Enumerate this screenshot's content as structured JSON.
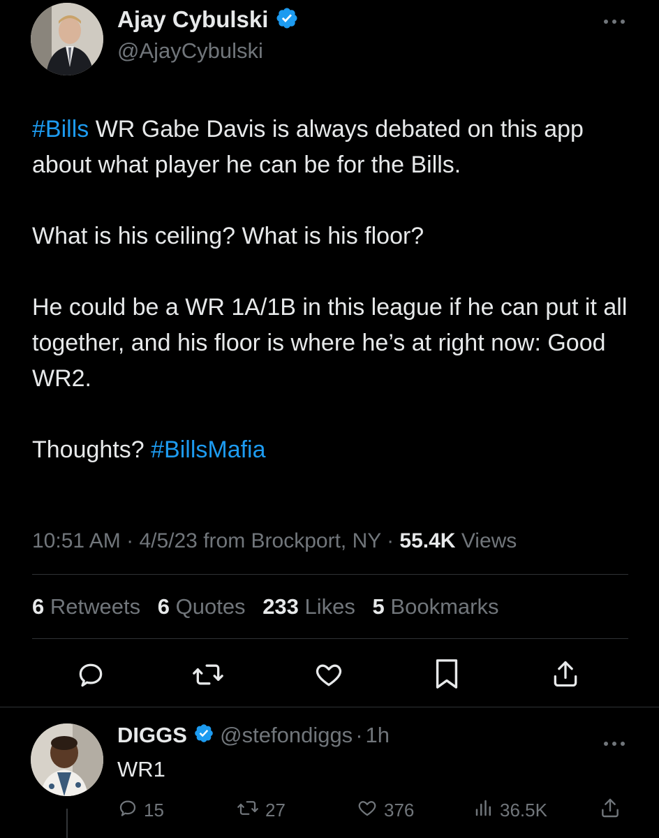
{
  "tweet": {
    "author_name": "Ajay Cybulski",
    "author_handle": "@AjayCybulski",
    "body": {
      "p1_hashtag": "#Bills",
      "p1_text": " WR Gabe Davis is always debated on this app about what player he can be for the Bills.",
      "p2": "What is his ceiling? What is his floor?",
      "p3": "He could be a WR 1A/1B in this league if he can put it all together, and his floor is where he’s at right now: Good WR2.",
      "p4_text": "Thoughts? ",
      "p4_hashtag": "#BillsMafia"
    },
    "meta": {
      "time": "10:51 AM",
      "date": "4/5/23",
      "location": "from Brockport, NY",
      "views_count": "55.4K",
      "views_label": "Views"
    },
    "stats": {
      "retweets_count": "6",
      "retweets_label": "Retweets",
      "quotes_count": "6",
      "quotes_label": "Quotes",
      "likes_count": "233",
      "likes_label": "Likes",
      "bookmarks_count": "5",
      "bookmarks_label": "Bookmarks"
    },
    "actions": [
      "reply-icon",
      "retweet-icon",
      "like-icon",
      "bookmark-icon",
      "share-icon"
    ]
  },
  "reply": {
    "author_name": "DIGGS",
    "author_handle": "@stefondiggs",
    "separator": "·",
    "time": "1h",
    "text": "WR1",
    "replies": "15",
    "retweets": "27",
    "likes": "376",
    "views": "36.5K"
  },
  "colors": {
    "background": "#000000",
    "text": "#e7e9ea",
    "muted": "#71767b",
    "accent": "#1d9bf0",
    "divider": "#2f3336"
  }
}
